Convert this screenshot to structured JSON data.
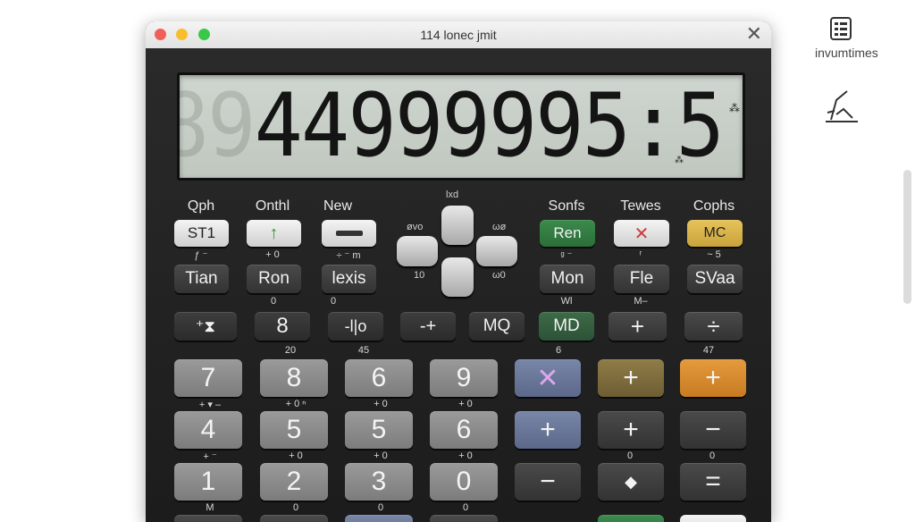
{
  "window": {
    "title": "114 lonec jmit",
    "close_glyph": "✕"
  },
  "display": {
    "ghost_digits": "8889",
    "lit_digits": "44999995:5",
    "ann_top": "⁂",
    "ann_bottom": "⁂"
  },
  "dpad": {
    "top": "lxd",
    "left": "øvo",
    "right": "ωø",
    "bottom_left": "10",
    "bottom_right": "ω0"
  },
  "row1": {
    "labels": [
      "Qph",
      "Onthl",
      "New",
      "Sonfs",
      "Tewes",
      "Cophs"
    ],
    "keys": [
      "ST1",
      "↑",
      "",
      "Ren",
      "✕",
      "MC"
    ],
    "subs": [
      "ƒ  ⁻",
      "+  0",
      "÷  ⁻  m",
      "ᵍ  ⁻",
      "ʳ",
      "~  5"
    ]
  },
  "row2": {
    "keys": [
      "Tian",
      "Ron",
      "lexis",
      "Mon",
      "Fle",
      "SVaa"
    ],
    "subs": [
      "",
      "0",
      "0",
      "Wl",
      "M–",
      ""
    ]
  },
  "row3": {
    "keys": [
      "⁺⧗",
      "8",
      "-l|o",
      "-+",
      "MQ",
      "MD",
      "+",
      "÷"
    ],
    "subs": [
      "20",
      "45",
      "6",
      "47"
    ]
  },
  "row4": {
    "keys": [
      "7",
      "8",
      "6",
      "9",
      "✕",
      "+",
      "+"
    ],
    "subs": [
      "+ ▾ –",
      "+ 0 ⁿ",
      "+ 0",
      "+ 0"
    ]
  },
  "row5": {
    "keys": [
      "4",
      "5",
      "5",
      "6",
      "+",
      "+",
      "−"
    ],
    "subs": [
      "+ ⁻",
      "+ 0",
      "+ 0",
      "+ 0",
      "0",
      "0"
    ]
  },
  "row6": {
    "keys": [
      "1",
      "2",
      "3",
      "0",
      "−",
      "◆",
      "="
    ],
    "subs": [
      "M",
      "0",
      "0",
      "0"
    ]
  },
  "side": {
    "label": "invumtimes"
  },
  "colors": {
    "green_key": "#3c8a4c",
    "gold_key": "#e6c35a",
    "blue_key": "#7886a8",
    "orange_key": "#e59a3c"
  }
}
